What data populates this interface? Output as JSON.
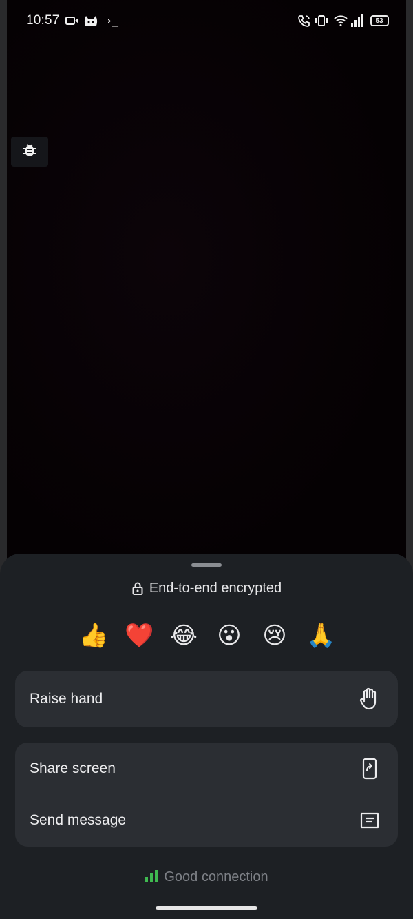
{
  "status_bar": {
    "time": "10:57",
    "left_icons": [
      "video-camera-icon",
      "cat-icon",
      "terminal-icon"
    ],
    "terminal_glyph": "›_",
    "right_icons": [
      "call-icon",
      "vibrate-icon",
      "wifi-icon",
      "signal-icon",
      "battery-icon"
    ],
    "battery_level": "53"
  },
  "debug_button": {
    "icon": "bug-icon"
  },
  "sheet": {
    "encryption": {
      "icon": "lock-icon",
      "text": "End-to-end encrypted"
    },
    "reactions": [
      {
        "emoji": "👍",
        "name": "thumbs-up"
      },
      {
        "emoji": "❤️",
        "name": "red-heart"
      },
      {
        "emoji": "😂",
        "name": "tears-of-joy"
      },
      {
        "emoji": "😮",
        "name": "open-mouth"
      },
      {
        "emoji": "😢",
        "name": "crying-face"
      },
      {
        "emoji": "🙏",
        "name": "folded-hands"
      }
    ],
    "raise_hand": {
      "label": "Raise hand",
      "icon": "hand-icon"
    },
    "share_screen": {
      "label": "Share screen",
      "icon": "share-screen-icon"
    },
    "send_message": {
      "label": "Send message",
      "icon": "message-icon"
    },
    "connection": {
      "text": "Good connection",
      "icon": "signal-bars-icon",
      "color": "#3fb950"
    }
  },
  "colors": {
    "screen_background": "#060104",
    "sheet_background": "#1d2024",
    "card_background": "#2b2e33",
    "text_primary": "#ececee",
    "text_muted": "#7d8086"
  }
}
